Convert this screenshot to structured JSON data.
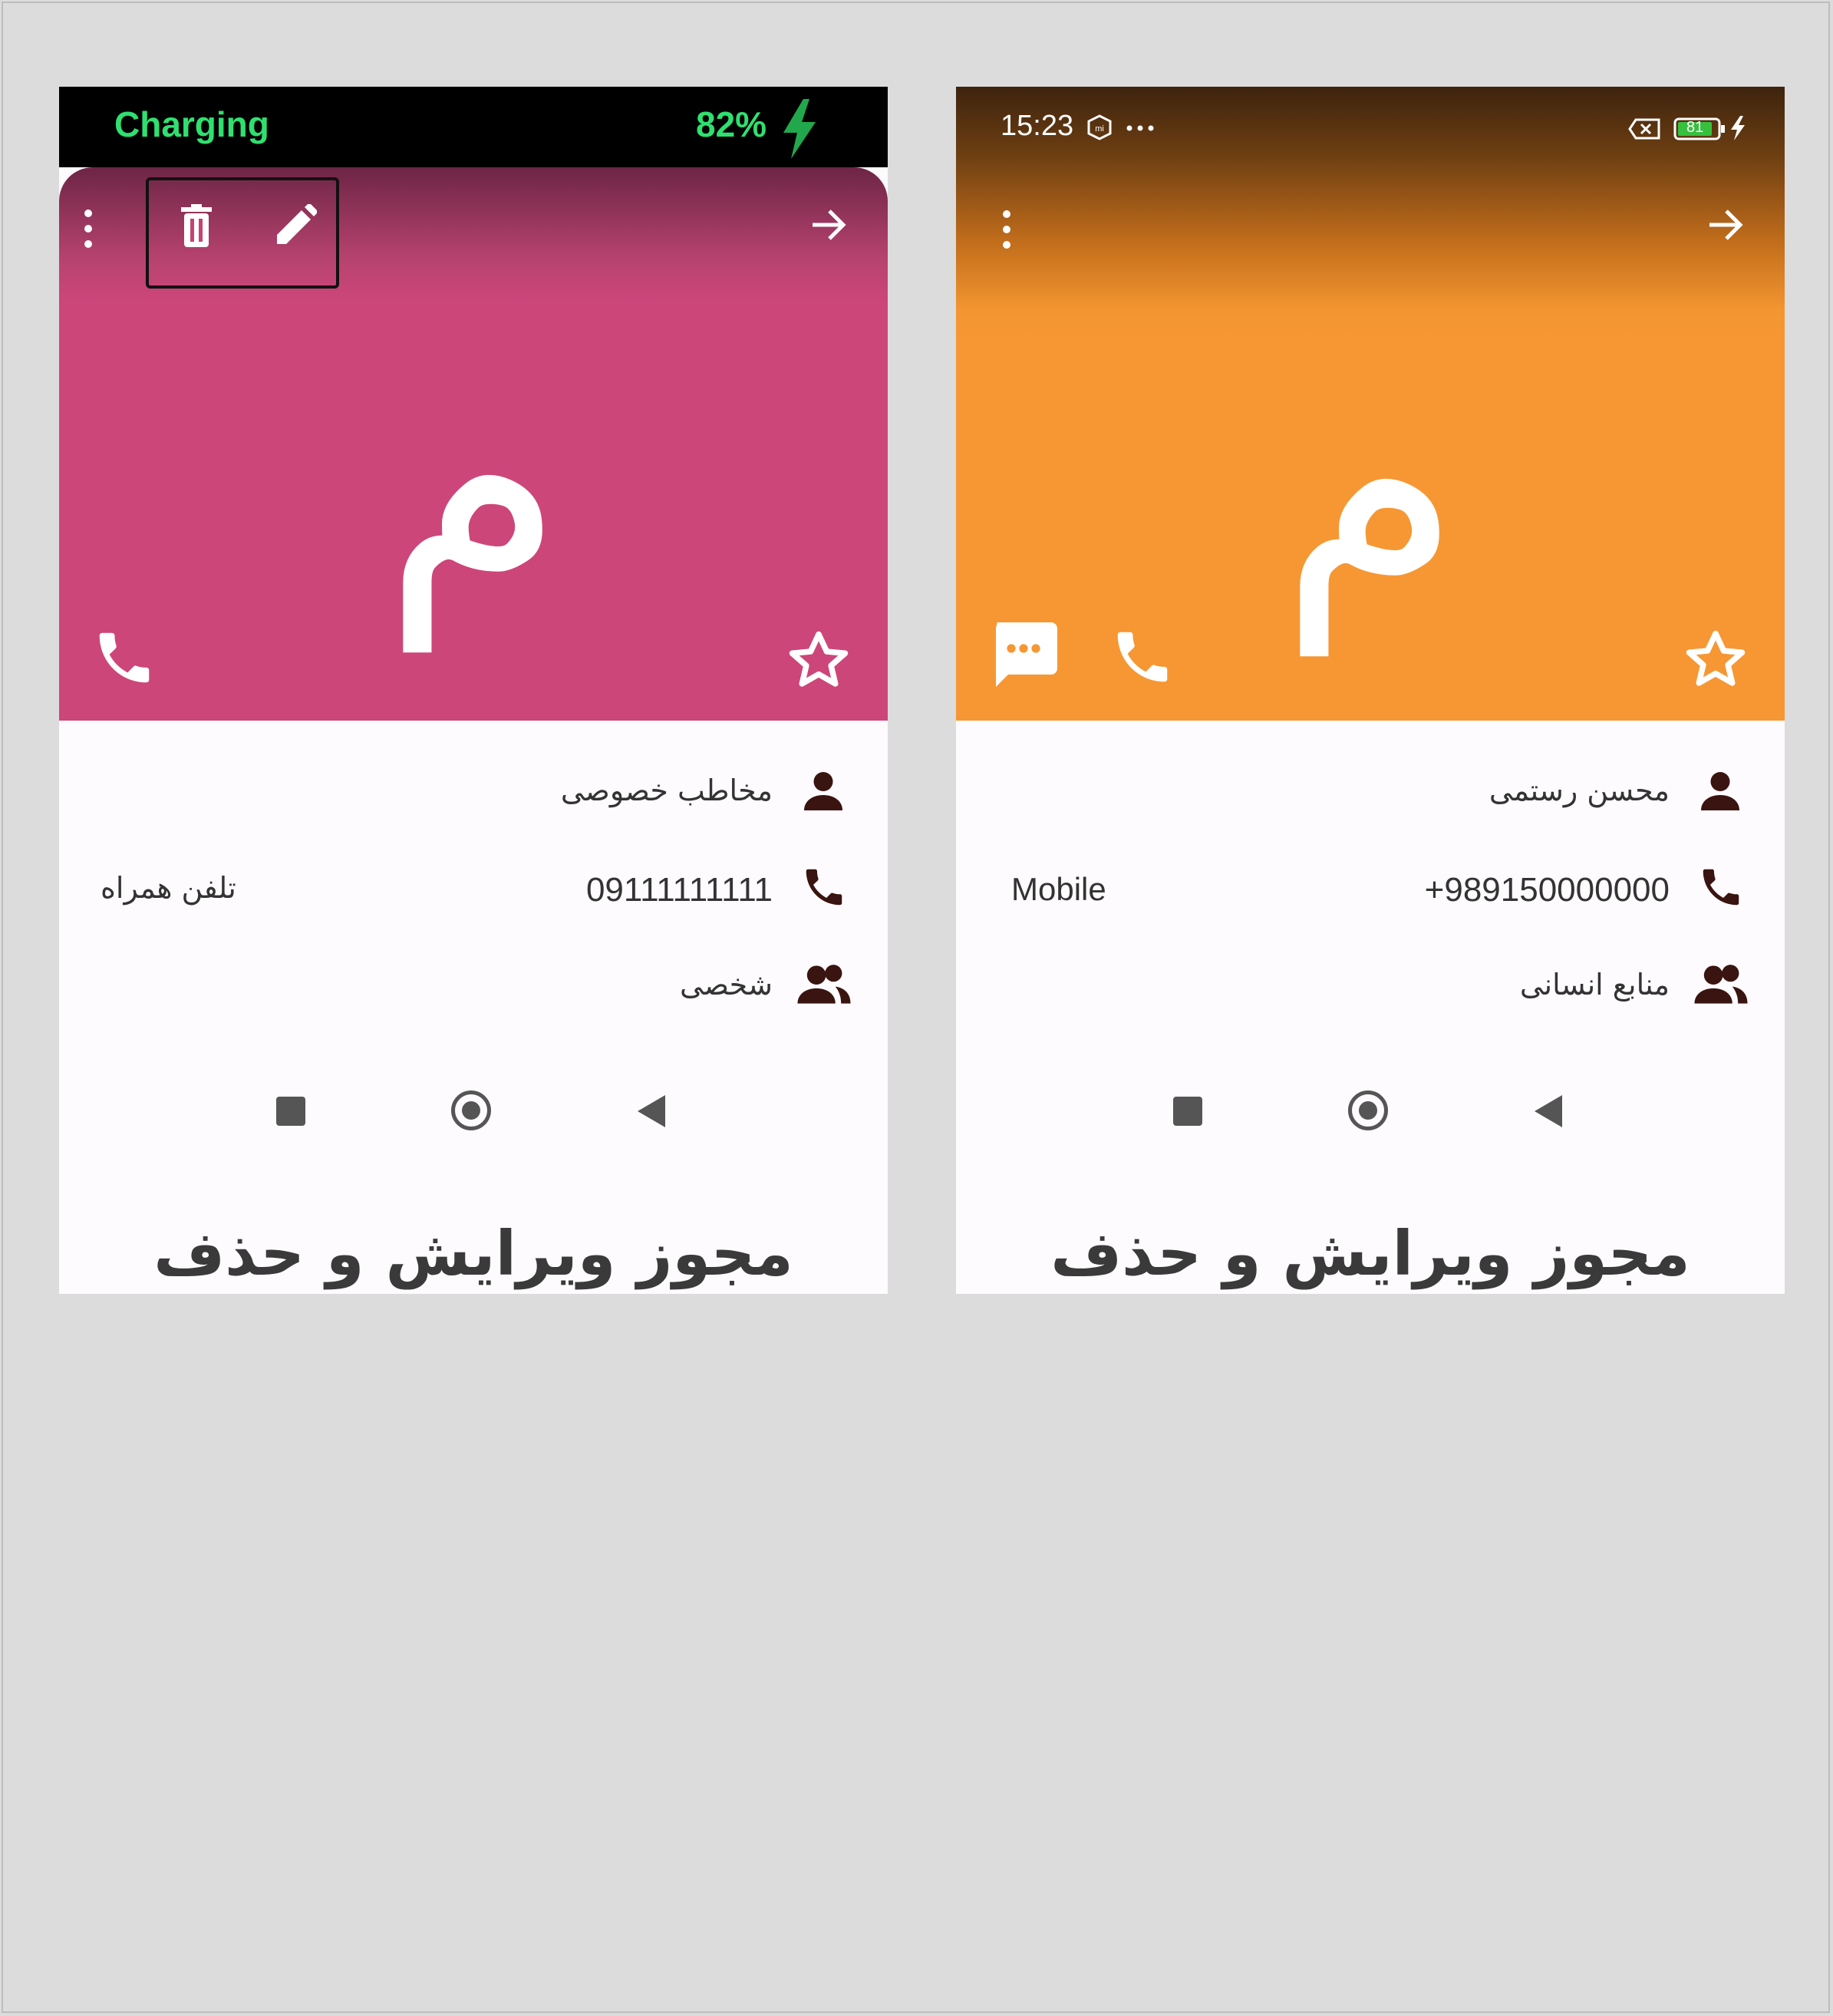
{
  "left_screen": {
    "status_bar": {
      "charging_label": "Charging",
      "battery_percent": "82%"
    },
    "avatar_letter": "م",
    "info": {
      "name": "مخاطب خصوصی",
      "phone": "09111111111",
      "phone_type": "تلفن همراه",
      "group": "شخصی"
    },
    "message": "مجوز ویرایش و حذف مخاطب خصوصی را دارد",
    "header_color": "#cd4679",
    "icons": [
      "more-vert-icon",
      "delete-icon",
      "edit-icon",
      "arrow-forward-icon",
      "call-icon",
      "star-outline-icon",
      "person-icon",
      "phone-icon",
      "group-icon"
    ]
  },
  "right_screen": {
    "status_bar": {
      "time": "15:23",
      "battery_level": "81"
    },
    "avatar_letter": "م",
    "info": {
      "name": "محسن رستمی",
      "phone": "+989150000000",
      "phone_type": "Mobile",
      "group": "منابع انسانی"
    },
    "message": "مجوز ویرایش و حذف مخاطب سازمانی را ندارد",
    "header_color": "#f69733",
    "icons": [
      "more-vert-icon",
      "arrow-forward-icon",
      "message-icon",
      "call-icon",
      "star-outline-icon",
      "person-icon",
      "phone-icon",
      "group-icon"
    ]
  }
}
